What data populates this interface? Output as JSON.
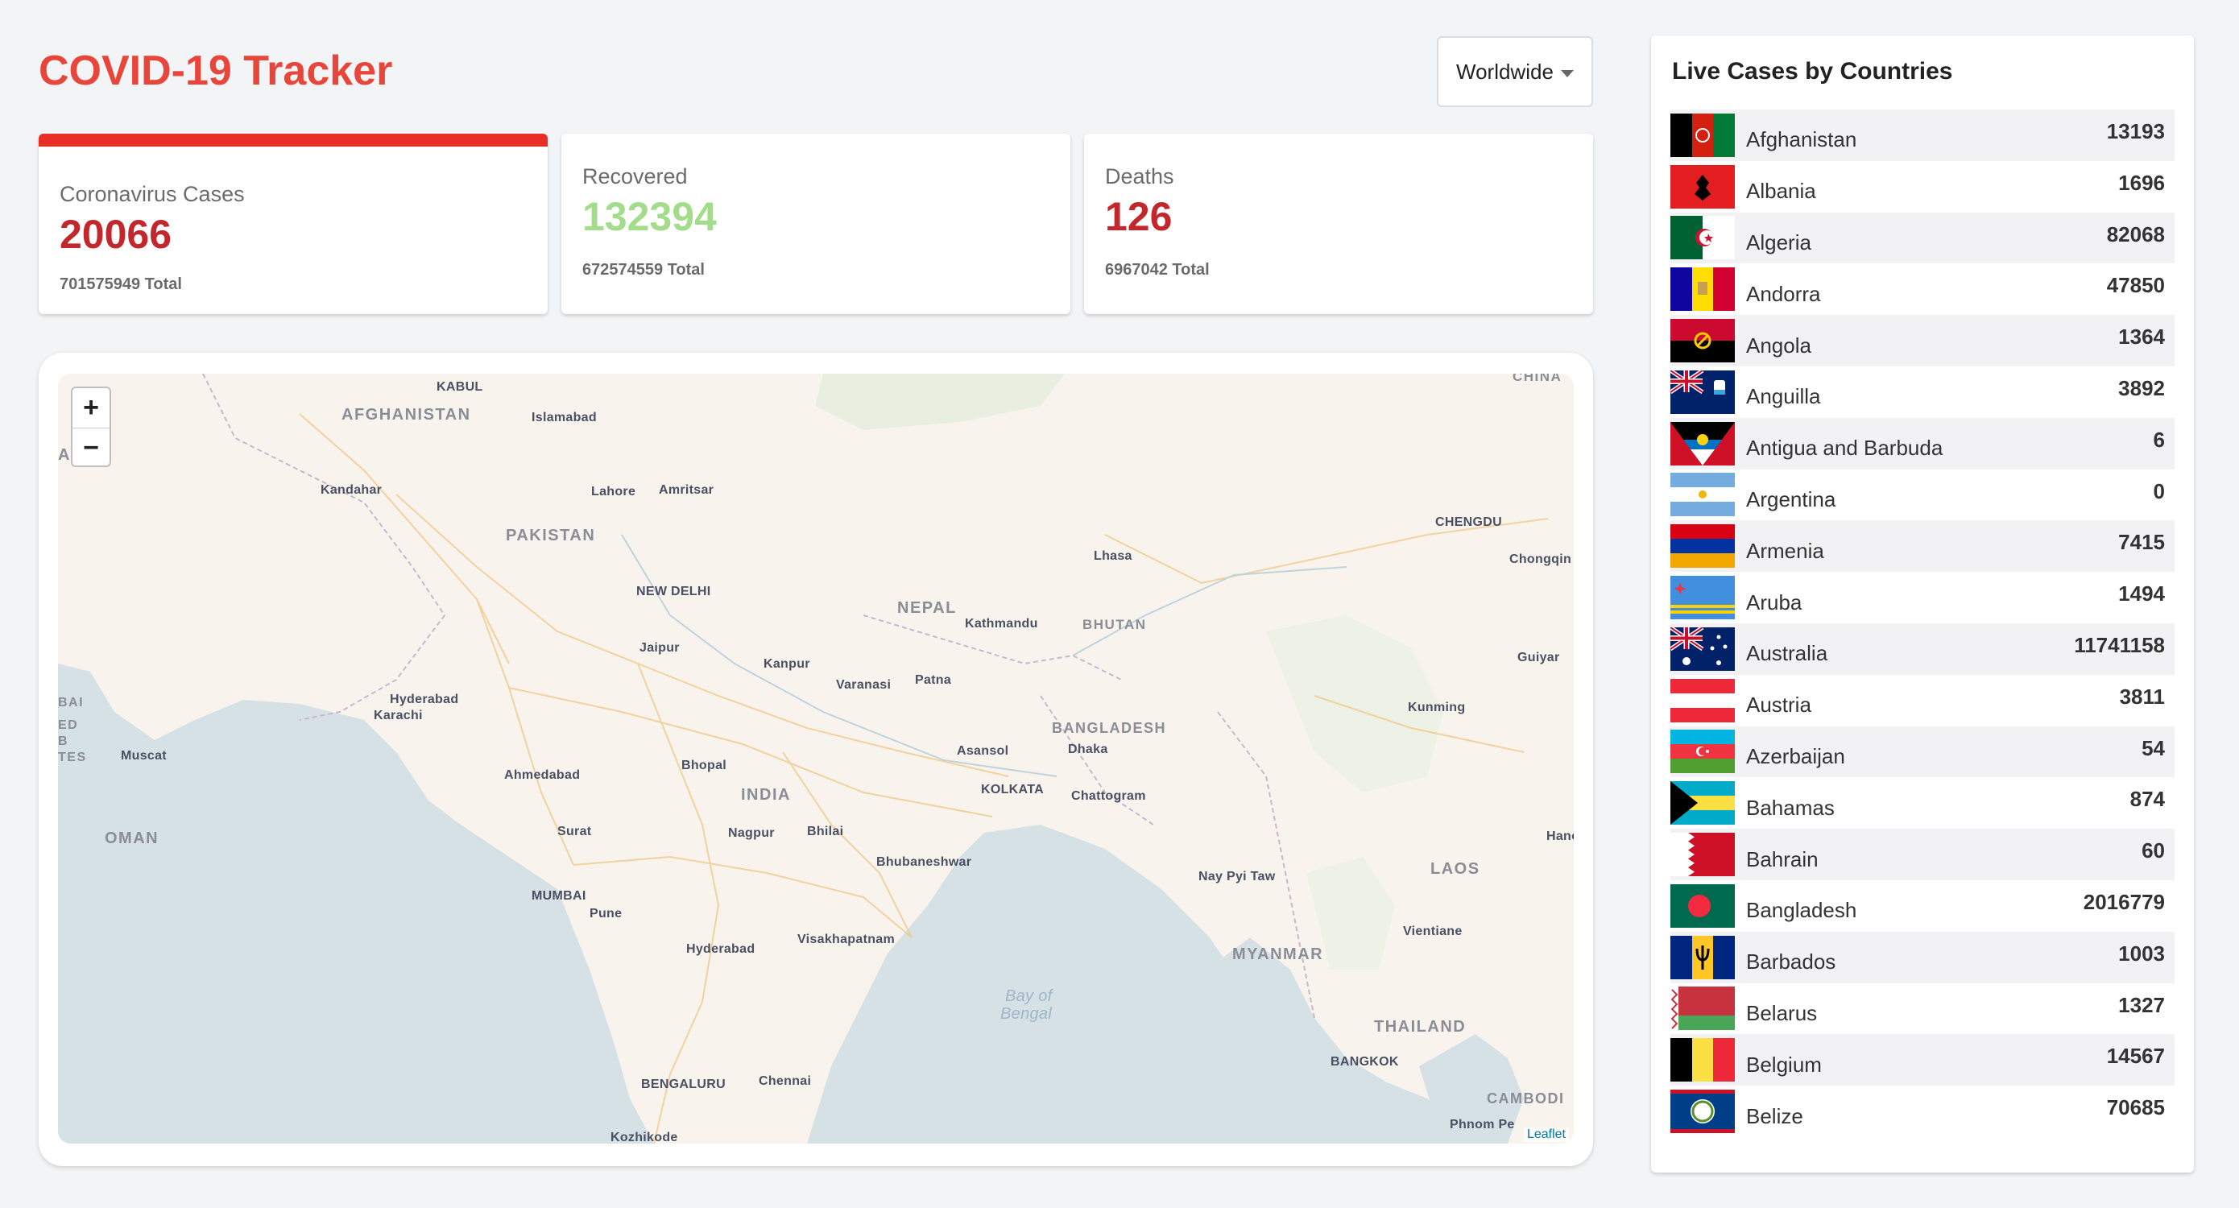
{
  "app": {
    "title": "COVID-19 Tracker"
  },
  "selector": {
    "value": "Worldwide"
  },
  "stats": {
    "cases": {
      "label": "Coronavirus Cases",
      "today": "20066",
      "total": "701575949 Total",
      "color": "#c1272d"
    },
    "recovered": {
      "label": "Recovered",
      "today": "132394",
      "total": "672574559 Total",
      "color": "#a3dd8b"
    },
    "deaths": {
      "label": "Deaths",
      "today": "126",
      "total": "6967042 Total",
      "color": "#c1272d"
    }
  },
  "map": {
    "zoom_in": "+",
    "zoom_out": "−",
    "attribution": "Leaflet",
    "labels": {
      "kabul": "KABUL",
      "afghanistan": "AFGHANISTAN",
      "islamabad": "Islamabad",
      "kandahar": "Kandahar",
      "lahore": "Lahore",
      "amritsar": "Amritsar",
      "pakistan": "PAKISTAN",
      "new_delhi": "NEW DELHI",
      "nepal": "NEPAL",
      "kathmandu": "Kathmandu",
      "bhutan": "BHUTAN",
      "lhasa": "Lhasa",
      "chengdu": "CHENGDU",
      "chongqing": "Chongqin",
      "china": "CHINA",
      "jaipur": "Jaipur",
      "kanpur": "Kanpur",
      "patna": "Patna",
      "varanasi": "Varanasi",
      "hyderabad_pk": "Hyderabad",
      "karachi": "Karachi",
      "guiyang": "Guiyar",
      "kunming": "Kunming",
      "bangladesh": "BANGLADESH",
      "asansol": "Asansol",
      "dhaka": "Dhaka",
      "bhopal": "Bhopal",
      "ahmedabad": "Ahmedabad",
      "muscat": "Muscat",
      "india": "INDIA",
      "kolkata": "KOLKATA",
      "chattogram": "Chattogram",
      "oman": "OMAN",
      "surat": "Surat",
      "nagpur": "Nagpur",
      "bhilai": "Bhilai",
      "hanoi": "Hanoi",
      "bhubaneshwar": "Bhubaneshwar",
      "nay_pyi_taw": "Nay Pyi Taw",
      "laos": "LAOS",
      "mumbai": "MUMBAI",
      "pune": "Pune",
      "vientiane": "Vientiane",
      "hyderabad_in": "Hyderabad",
      "visakhapatnam": "Visakhapatnam",
      "myanmar": "MYANMAR",
      "bay": "Bay of",
      "bengal": "Bengal",
      "thailand": "THAILAND",
      "bangkok": "BANGKOK",
      "bengaluru": "BENGALURU",
      "chennai": "Chennai",
      "cambodia": "CAMBODI",
      "kozhikode": "Kozhikode",
      "phnom_penh": "Phnom Pe",
      "ai_left": "AI",
      "bai_left": "BAI",
      "ed_left": "ED",
      "b_left": "B",
      "tes_left": "TES"
    }
  },
  "table": {
    "title": "Live Cases by Countries",
    "rows": [
      {
        "country": "Afghanistan",
        "cases": "13193",
        "flag": "afghanistan"
      },
      {
        "country": "Albania",
        "cases": "1696",
        "flag": "albania"
      },
      {
        "country": "Algeria",
        "cases": "82068",
        "flag": "algeria"
      },
      {
        "country": "Andorra",
        "cases": "47850",
        "flag": "andorra"
      },
      {
        "country": "Angola",
        "cases": "1364",
        "flag": "angola"
      },
      {
        "country": "Anguilla",
        "cases": "3892",
        "flag": "anguilla"
      },
      {
        "country": "Antigua and Barbuda",
        "cases": "6",
        "flag": "antigua"
      },
      {
        "country": "Argentina",
        "cases": "0",
        "flag": "argentina"
      },
      {
        "country": "Armenia",
        "cases": "7415",
        "flag": "armenia"
      },
      {
        "country": "Aruba",
        "cases": "1494",
        "flag": "aruba"
      },
      {
        "country": "Australia",
        "cases": "11741158",
        "flag": "australia"
      },
      {
        "country": "Austria",
        "cases": "3811",
        "flag": "austria"
      },
      {
        "country": "Azerbaijan",
        "cases": "54",
        "flag": "azerbaijan"
      },
      {
        "country": "Bahamas",
        "cases": "874",
        "flag": "bahamas"
      },
      {
        "country": "Bahrain",
        "cases": "60",
        "flag": "bahrain"
      },
      {
        "country": "Bangladesh",
        "cases": "2016779",
        "flag": "bangladesh"
      },
      {
        "country": "Barbados",
        "cases": "1003",
        "flag": "barbados"
      },
      {
        "country": "Belarus",
        "cases": "1327",
        "flag": "belarus"
      },
      {
        "country": "Belgium",
        "cases": "14567",
        "flag": "belgium"
      },
      {
        "country": "Belize",
        "cases": "70685",
        "flag": "belize"
      }
    ]
  }
}
